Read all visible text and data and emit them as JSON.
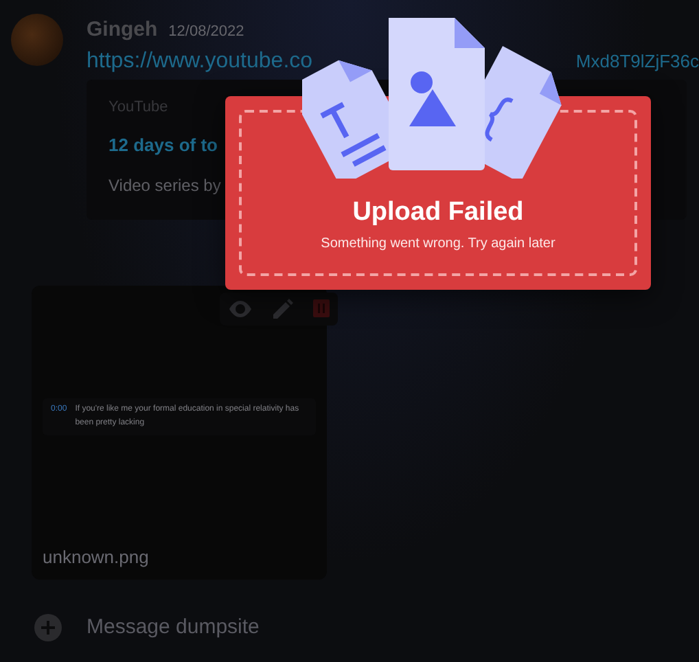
{
  "message": {
    "author": "Gingeh",
    "timestamp": "12/08/2022",
    "link_start": "https://www.youtube.co",
    "link_end": "Mxd8T9lZjF36c",
    "embed": {
      "provider": "YouTube",
      "title": "12 days of to",
      "description": "Video series by"
    }
  },
  "attachment": {
    "filename": "unknown.png",
    "caption_time": "0:00",
    "caption_text": "If you're like me your formal education in special relativity has been pretty lacking"
  },
  "composer": {
    "placeholder": "Message dumpsite"
  },
  "upload_error": {
    "title": "Upload Failed",
    "message": "Something went wrong. Try again later"
  }
}
